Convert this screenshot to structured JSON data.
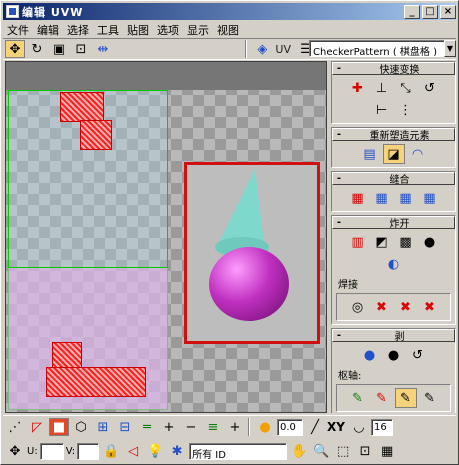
{
  "window": {
    "title": "编辑 UVW",
    "controls": {
      "minimize": "_",
      "maximize": "□",
      "close": "×"
    }
  },
  "menu": {
    "items": [
      "文件",
      "编辑",
      "选择",
      "工具",
      "贴图",
      "选项",
      "显示",
      "视图"
    ]
  },
  "toolbar": {
    "uv_label": "UV",
    "texture_dropdown": "CheckerPattern ( 棋盘格 )"
  },
  "panels": {
    "quick_transform": {
      "title": "快速变换",
      "toggle": "-"
    },
    "reshape": {
      "title": "重新塑造元素",
      "toggle": "-"
    },
    "stitch": {
      "title": "缝合",
      "toggle": "-"
    },
    "explode": {
      "title": "炸开",
      "toggle": "-",
      "weld_label": "焊接"
    },
    "peel": {
      "title": "剥",
      "toggle": "-",
      "pivot_label": "枢轴:"
    }
  },
  "bottom": {
    "spinner_value": "0.0",
    "xy_label": "XY",
    "page_value": "16",
    "u_label": "U:",
    "v_label": "V:",
    "filter_dropdown": "所有 ID"
  },
  "colors": {
    "title_start": "#0a246a",
    "title_end": "#a6caf0",
    "selection_red": "#d01010",
    "active_yellow": "#f6d37b"
  }
}
